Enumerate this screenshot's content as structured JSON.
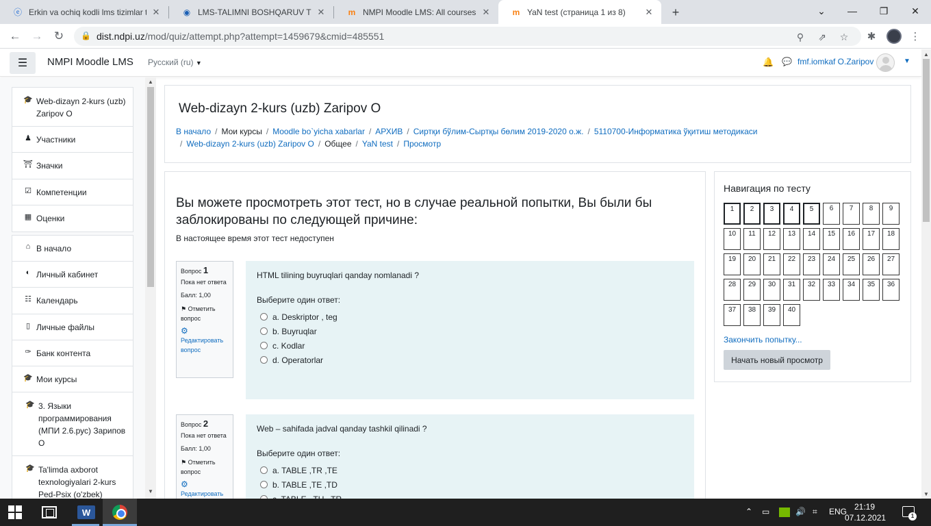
{
  "browser": {
    "tabs": [
      {
        "title": "Erkin va ochiq kodli lms tizimlar t",
        "icon": "edge-icon",
        "active": false
      },
      {
        "title": "LMS-TALIMNI BOSHQARUV TIZIM",
        "icon": "site-icon",
        "active": false
      },
      {
        "title": "NMPI Moodle LMS: All courses",
        "icon": "moodle-icon",
        "active": false
      },
      {
        "title": "YaN test (страница 1 из 8)",
        "icon": "moodle-icon",
        "active": true
      }
    ],
    "url_host": "dist.ndpi.uz",
    "url_path": "/mod/quiz/attempt.php?attempt=1459679&cmid=485551"
  },
  "navbar": {
    "site_name": "NMPI Moodle LMS",
    "language": "Русский (ru)",
    "user_name": "fmf.iomkaf O.Zaripov"
  },
  "drawer": {
    "course_group": [
      {
        "label": "Web-dizayn 2-kurs (uzb) Zaripov O",
        "icon": "graduation-cap-icon"
      },
      {
        "label": "Участники",
        "icon": "users-icon"
      },
      {
        "label": "Значки",
        "icon": "shield-icon"
      },
      {
        "label": "Компетенции",
        "icon": "checkbox-icon"
      },
      {
        "label": "Оценки",
        "icon": "table-icon"
      }
    ],
    "site_group": [
      {
        "label": "В начало",
        "icon": "home-icon"
      },
      {
        "label": "Личный кабинет",
        "icon": "dashboard-icon"
      },
      {
        "label": "Календарь",
        "icon": "calendar-icon"
      },
      {
        "label": "Личные файлы",
        "icon": "file-icon"
      },
      {
        "label": "Банк контента",
        "icon": "brush-icon"
      },
      {
        "label": "Мои курсы",
        "icon": "graduation-cap-icon"
      },
      {
        "label": "3. Языки программирования (МПИ 2.6.рус) Зарипов О",
        "icon": "graduation-cap-icon"
      },
      {
        "label": "Ta'limda axborot texnologiyalari 2-kurs Ped-Psix (o'zbek)",
        "icon": "graduation-cap-icon"
      }
    ]
  },
  "header": {
    "course_title": "Web-dizayn 2-kurs (uzb) Zaripov O",
    "breadcrumbs": [
      {
        "label": "В начало",
        "link": true
      },
      {
        "label": "Мои курсы",
        "link": false
      },
      {
        "label": "Moodle bo`yicha xabarlar",
        "link": true
      },
      {
        "label": "АРХИВ",
        "link": true
      },
      {
        "label": "Сиртқи бўлим-Сыртқы бөлим 2019-2020 о.ж.",
        "link": true
      },
      {
        "label": "5110700-Информатика ўқитиш методикаси",
        "link": true
      },
      {
        "label": "Web-dizayn 2-kurs (uzb) Zaripov O",
        "link": true
      },
      {
        "label": "Общее",
        "link": false
      },
      {
        "label": "YaN test",
        "link": true
      },
      {
        "label": "Просмотр",
        "link": true
      }
    ]
  },
  "main": {
    "preview_heading": "Вы можете просмотреть этот тест, но в случае реальной попытки, Вы были бы заблокированы по следующей причине:",
    "preview_reason": "В настоящее время этот тест недоступен",
    "questions": [
      {
        "label": "Вопрос",
        "number": "1",
        "state": "Пока нет ответа",
        "mark": "Балл: 1,00",
        "flag": "Отметить вопрос",
        "edit": "Редактировать вопрос",
        "text": "HTML tilining buyruqlari qanday nomlanadi ?",
        "prompt": "Выберите один ответ:",
        "options": [
          "a. Deskriptor , teg",
          "b. Buyruqlar",
          "c. Kodlar",
          "d. Operatorlar"
        ]
      },
      {
        "label": "Вопрос",
        "number": "2",
        "state": "Пока нет ответа",
        "mark": "Балл: 1,00",
        "flag": "Отметить вопрос",
        "edit": "Редактировать вопрос",
        "text": "Web – sahifada jadval qanday tashkil qilinadi ?",
        "prompt": "Выберите один ответ:",
        "options": [
          "a. TABLE ,TR ,TE",
          "b. TABLE ,TE ,TD",
          "c. TABLE , TU , TR"
        ]
      }
    ]
  },
  "quiz_nav": {
    "title": "Навигация по тесту",
    "buttons": [
      "1",
      "2",
      "3",
      "4",
      "5",
      "6",
      "7",
      "8",
      "9",
      "10",
      "11",
      "12",
      "13",
      "14",
      "15",
      "16",
      "17",
      "18",
      "19",
      "20",
      "21",
      "22",
      "23",
      "24",
      "25",
      "26",
      "27",
      "28",
      "29",
      "30",
      "31",
      "32",
      "33",
      "34",
      "35",
      "36",
      "37",
      "38",
      "39",
      "40"
    ],
    "current_page_count": 5,
    "finish_link": "Закончить попытку...",
    "new_preview_button": "Начать новый просмотр"
  },
  "taskbar": {
    "language": "ENG",
    "time": "21:19",
    "date": "07.12.2021",
    "notifications": "1"
  }
}
